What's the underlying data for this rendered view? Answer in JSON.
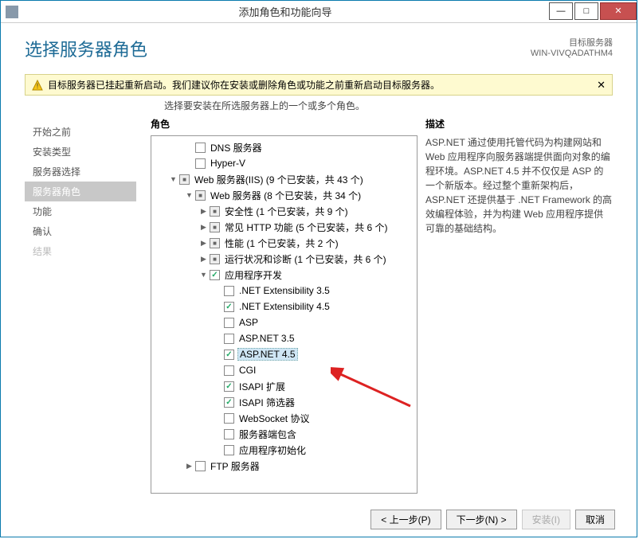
{
  "window": {
    "title": "添加角色和功能向导",
    "heading": "选择服务器角色",
    "target_label": "目标服务器",
    "target_server": "WIN-VIVQADATHM4"
  },
  "notice": {
    "text": "目标服务器已挂起重新启动。我们建议你在安装或删除角色或功能之前重新启动目标服务器。"
  },
  "subtitle": "选择要安装在所选服务器上的一个或多个角色。",
  "nav": {
    "items": [
      {
        "label": "开始之前",
        "state": "normal"
      },
      {
        "label": "安装类型",
        "state": "normal"
      },
      {
        "label": "服务器选择",
        "state": "normal"
      },
      {
        "label": "服务器角色",
        "state": "active"
      },
      {
        "label": "功能",
        "state": "normal"
      },
      {
        "label": "确认",
        "state": "normal"
      },
      {
        "label": "结果",
        "state": "disabled"
      }
    ]
  },
  "columns": {
    "roles": "角色",
    "desc": "描述"
  },
  "tree": [
    {
      "indent": 1,
      "exp": "",
      "cb": "empty",
      "label": "DNS 服务器"
    },
    {
      "indent": 1,
      "exp": "",
      "cb": "empty",
      "label": "Hyper-V"
    },
    {
      "indent": 0,
      "exp": "▼",
      "cb": "mixed",
      "label": "Web 服务器(IIS) (9 个已安装，共 43 个)"
    },
    {
      "indent": 1,
      "exp": "▼",
      "cb": "mixed",
      "label": "Web 服务器 (8 个已安装，共 34 个)"
    },
    {
      "indent": 2,
      "exp": "▶",
      "cb": "mixed",
      "label": "安全性 (1 个已安装，共 9 个)"
    },
    {
      "indent": 2,
      "exp": "▶",
      "cb": "mixed",
      "label": "常见 HTTP 功能 (5 个已安装，共 6 个)"
    },
    {
      "indent": 2,
      "exp": "▶",
      "cb": "mixed",
      "label": "性能 (1 个已安装，共 2 个)"
    },
    {
      "indent": 2,
      "exp": "▶",
      "cb": "mixed",
      "label": "运行状况和诊断 (1 个已安装，共 6 个)"
    },
    {
      "indent": 2,
      "exp": "▼",
      "cb": "checked",
      "label": "应用程序开发"
    },
    {
      "indent": 3,
      "exp": "",
      "cb": "empty",
      "label": ".NET Extensibility 3.5"
    },
    {
      "indent": 3,
      "exp": "",
      "cb": "checked",
      "label": ".NET Extensibility 4.5"
    },
    {
      "indent": 3,
      "exp": "",
      "cb": "empty",
      "label": "ASP"
    },
    {
      "indent": 3,
      "exp": "",
      "cb": "empty",
      "label": "ASP.NET 3.5"
    },
    {
      "indent": 3,
      "exp": "",
      "cb": "checked",
      "label": "ASP.NET 4.5",
      "selected": true
    },
    {
      "indent": 3,
      "exp": "",
      "cb": "empty",
      "label": "CGI"
    },
    {
      "indent": 3,
      "exp": "",
      "cb": "checked",
      "label": "ISAPI 扩展"
    },
    {
      "indent": 3,
      "exp": "",
      "cb": "checked",
      "label": "ISAPI 筛选器"
    },
    {
      "indent": 3,
      "exp": "",
      "cb": "empty",
      "label": "WebSocket 协议"
    },
    {
      "indent": 3,
      "exp": "",
      "cb": "empty",
      "label": "服务器端包含"
    },
    {
      "indent": 3,
      "exp": "",
      "cb": "empty",
      "label": "应用程序初始化"
    },
    {
      "indent": 1,
      "exp": "▶",
      "cb": "empty",
      "label": "FTP 服务器"
    }
  ],
  "description": "ASP.NET 通过使用托管代码为构建网站和 Web 应用程序向服务器端提供面向对象的编程环境。ASP.NET 4.5 并不仅仅是 ASP 的一个新版本。经过整个重新架构后，ASP.NET 还提供基于 .NET Framework 的高效编程体验，并为构建 Web 应用程序提供可靠的基础结构。",
  "buttons": {
    "prev": "< 上一步(P)",
    "next": "下一步(N) >",
    "install": "安装(I)",
    "cancel": "取消"
  }
}
